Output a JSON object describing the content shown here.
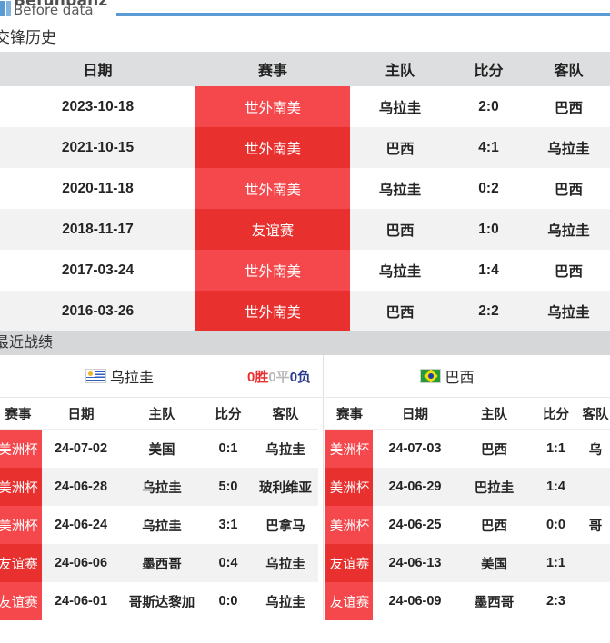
{
  "brand": {
    "title": "Befunbanz",
    "subtitle": "Before data"
  },
  "h2h": {
    "section_title": "交锋历史",
    "headers": [
      "日期",
      "赛事",
      "主队",
      "比分",
      "客队"
    ],
    "rows": [
      {
        "date": "2023-10-18",
        "comp": "世外南美",
        "home": "乌拉圭",
        "score": "2:0",
        "away": "巴西"
      },
      {
        "date": "2021-10-15",
        "comp": "世外南美",
        "home": "巴西",
        "score": "4:1",
        "away": "乌拉圭"
      },
      {
        "date": "2020-11-18",
        "comp": "世外南美",
        "home": "乌拉圭",
        "score": "0:2",
        "away": "巴西"
      },
      {
        "date": "2018-11-17",
        "comp": "友谊赛",
        "home": "巴西",
        "score": "1:0",
        "away": "乌拉圭"
      },
      {
        "date": "2017-03-24",
        "comp": "世外南美",
        "home": "乌拉圭",
        "score": "1:4",
        "away": "巴西"
      },
      {
        "date": "2016-03-26",
        "comp": "世外南美",
        "home": "巴西",
        "score": "2:2",
        "away": "乌拉圭"
      }
    ]
  },
  "recent": {
    "section_title": "最近战绩",
    "record": {
      "wins": "0胜",
      "draws": "0平",
      "losses": "0负"
    },
    "headers": [
      "赛事",
      "日期",
      "主队",
      "比分",
      "客队"
    ],
    "left": {
      "team": "乌拉圭",
      "flag": "uruguay-flag",
      "rows": [
        {
          "comp": "美洲杯",
          "date": "24-07-02",
          "home": "美国",
          "score": "0:1",
          "away": "乌拉圭"
        },
        {
          "comp": "美洲杯",
          "date": "24-06-28",
          "home": "乌拉圭",
          "score": "5:0",
          "away": "玻利维亚"
        },
        {
          "comp": "美洲杯",
          "date": "24-06-24",
          "home": "乌拉圭",
          "score": "3:1",
          "away": "巴拿马"
        },
        {
          "comp": "友谊赛",
          "date": "24-06-06",
          "home": "墨西哥",
          "score": "0:4",
          "away": "乌拉圭"
        },
        {
          "comp": "友谊赛",
          "date": "24-06-01",
          "home": "哥斯达黎加",
          "score": "0:0",
          "away": "乌拉圭"
        }
      ]
    },
    "right": {
      "team": "巴西",
      "flag": "brazil-flag",
      "rows": [
        {
          "comp": "美洲杯",
          "date": "24-07-03",
          "home": "巴西",
          "score": "1:1",
          "away": "乌"
        },
        {
          "comp": "美洲杯",
          "date": "24-06-29",
          "home": "巴拉圭",
          "score": "1:4",
          "away": ""
        },
        {
          "comp": "美洲杯",
          "date": "24-06-25",
          "home": "巴西",
          "score": "0:0",
          "away": "哥"
        },
        {
          "comp": "友谊赛",
          "date": "24-06-13",
          "home": "美国",
          "score": "1:1",
          "away": ""
        },
        {
          "comp": "友谊赛",
          "date": "24-06-09",
          "home": "墨西哥",
          "score": "2:3",
          "away": ""
        }
      ]
    }
  },
  "colors": {
    "brand_blue": "#5b9bd5",
    "comp_red": "#f4484c",
    "comp_red_dark": "#e8312f",
    "band_gray": "#d5d7d8",
    "header_gray": "#dcdedf",
    "row_stripe": "#f2f2f2"
  }
}
